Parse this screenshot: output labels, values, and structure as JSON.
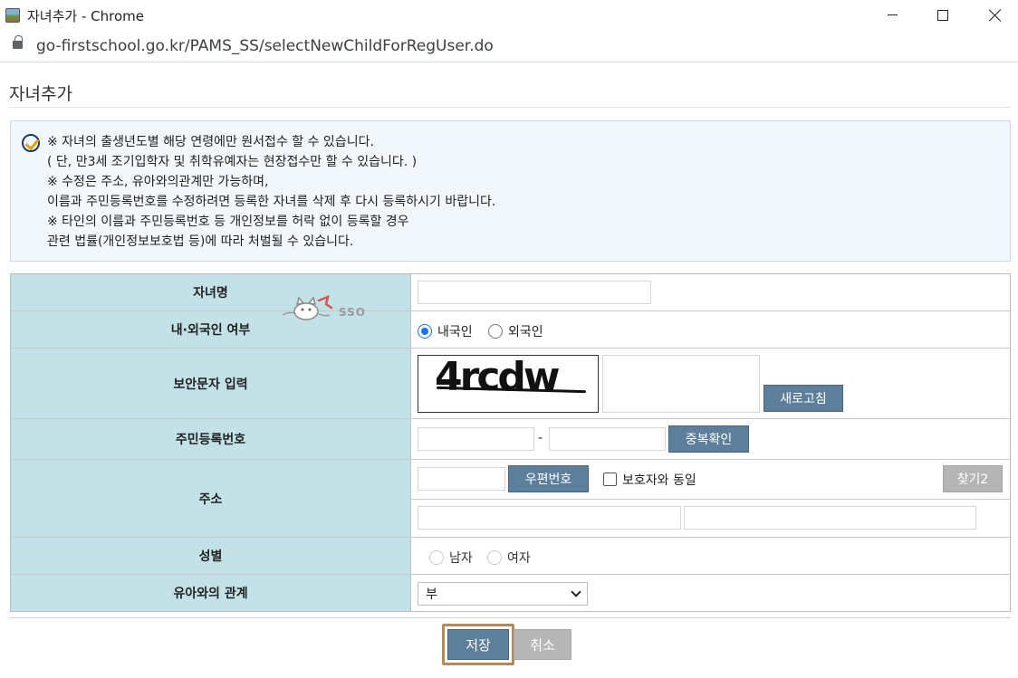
{
  "window": {
    "title": "자녀추가 - Chrome",
    "url": "go-firstschool.go.kr/PAMS_SS/selectNewChildForRegUser.do"
  },
  "page": {
    "title": "자녀추가"
  },
  "notice": {
    "lines": [
      "※ 자녀의 출생년도별 해당 연령에만 원서접수 할 수 있습니다.",
      "( 단, 만3세 조기입학자 및 취학유예자는 현장접수만 할 수 있습니다. )",
      "※ 수정은 주소, 유아와의관계만 가능하며,",
      "이름과 주민등록번호를 수정하려면 등록한 자녀를 삭제 후 다시 등록하시기 바랍니다.",
      "※ 타인의 이름과 주민등록번호 등 개인정보를 허락 없이 등록할 경우",
      "관련 법률(개인정보보호법 등)에 따라 처벌될 수 있습니다."
    ]
  },
  "form": {
    "name_label": "자녀명",
    "name_value": "",
    "nationality_label": "내·외국인 여부",
    "nationality_options": [
      "내국인",
      "외국인"
    ],
    "nationality_selected": "내국인",
    "captcha_label": "보안문자 입력",
    "captcha_text": "4rcdw",
    "captcha_input_value": "",
    "refresh_button": "새로고침",
    "rrn_label": "주민등록번호",
    "rrn_separator": "-",
    "rrn_front_value": "",
    "rrn_back_value": "",
    "duplicate_check_button": "중복확인",
    "address_label": "주소",
    "zipcode_value": "",
    "zipcode_button": "우편번호",
    "same_as_guardian_label": "보호자와 동일",
    "find2_button": "찾기2",
    "address1_value": "",
    "address2_value": "",
    "gender_label": "성별",
    "gender_options": [
      "남자",
      "여자"
    ],
    "relation_label": "유아와의 관계",
    "relation_selected": "부"
  },
  "sso": {
    "text": "SSO"
  },
  "actions": {
    "save": "저장",
    "cancel": "취소"
  }
}
